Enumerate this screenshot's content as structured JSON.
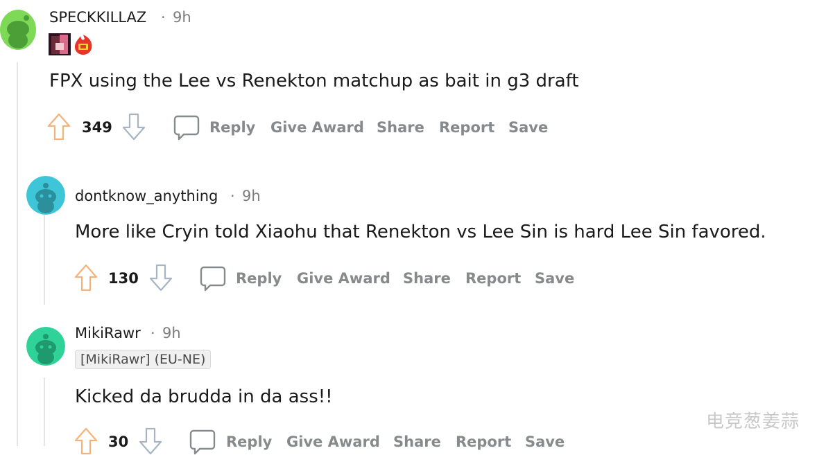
{
  "colors": {
    "upvote": "#f5b27a",
    "downvote": "#a8b4bf",
    "action_text": "#878a8c",
    "thread_line": "#e5e5e5",
    "avatar_green": "#7ed957",
    "avatar_cyan": "#3ec6d8",
    "avatar_teal": "#2fd39a"
  },
  "comments": [
    {
      "username": "SPECKKILLAZ",
      "sep": "·",
      "time": "9h",
      "flair_icons": [
        "fpx-player-flair-icon",
        "fpx-logo-flair-icon"
      ],
      "body": "FPX using the Lee vs Renekton matchup as bait in g3 draft",
      "score": "349",
      "actions": [
        "Reply",
        "Give Award",
        "Share",
        "Report",
        "Save"
      ]
    },
    {
      "username": "dontknow_anything",
      "sep": "·",
      "time": "9h",
      "body": "More like Cryin told Xiaohu that Renekton vs Lee Sin is hard Lee Sin favored.",
      "score": "130",
      "actions": [
        "Reply",
        "Give Award",
        "Share",
        "Report",
        "Save"
      ]
    },
    {
      "username": "MikiRawr",
      "sep": "·",
      "time": "9h",
      "flair_text": "[MikiRawr] (EU-NE)",
      "body": "Kicked da brudda in da ass!!",
      "score": "30",
      "actions": [
        "Reply",
        "Give Award",
        "Share",
        "Report",
        "Save"
      ]
    }
  ],
  "watermark": "电竞葱姜蒜"
}
